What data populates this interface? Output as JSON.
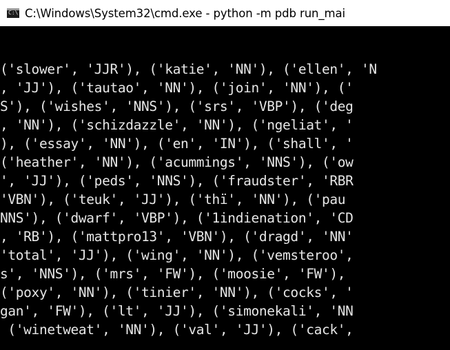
{
  "window": {
    "title": "C:\\Windows\\System32\\cmd.exe - python  -m pdb run_mai",
    "icon": "cmd-icon"
  },
  "console": {
    "lines": [
      "('slower', 'JJR'), ('katie', 'NN'), ('ellen', 'N",
      ", 'JJ'), ('tautao', 'NN'), ('join', 'NN'), ('",
      "S'), ('wishes', 'NNS'), ('srs', 'VBP'), ('deg",
      ", 'NN'), ('schizdazzle', 'NN'), ('ngeliat', '",
      "), ('essay', 'NN'), ('en', 'IN'), ('shall', '",
      "('heather', 'NN'), ('acummings', 'NNS'), ('ow",
      "', 'JJ'), ('peds', 'NNS'), ('fraudster', 'RBR",
      "'VBN'), ('teuk', 'JJ'), ('thï', 'NN'), ('pau",
      "NNS'), ('dwarf', 'VBP'), ('1indienation', 'CD",
      ", 'RB'), ('mattpro13', 'VBN'), ('dragd', 'NN'",
      "'total', 'JJ'), ('wing', 'NN'), ('vemsteroo',",
      "s', 'NNS'), ('mrs', 'FW'), ('moosie', 'FW'),",
      "('poxy', 'NN'), ('tinier', 'NN'), ('cocks', '",
      "gan', 'FW'), ('lt', 'JJ'), ('simonekali', 'NN",
      " ('winetweat', 'NN'), ('val', 'JJ'), ('cack',"
    ]
  }
}
